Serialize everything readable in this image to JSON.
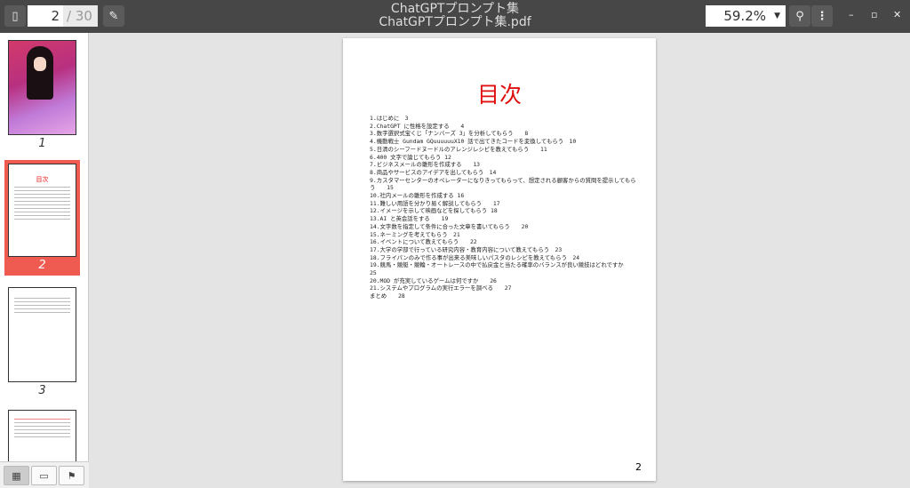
{
  "toolbar": {
    "current_page": "2",
    "total_pages": "/ 30",
    "title": "ChatGPTプロンプト集",
    "filename": "ChatGPTプロンプト集.pdf",
    "zoom": "59.2%"
  },
  "thumbnails": [
    {
      "label": "1"
    },
    {
      "label": "2"
    },
    {
      "label": "3"
    }
  ],
  "page": {
    "heading": "目次",
    "number": "2",
    "toc": [
      "1.はじめに　3",
      "2.ChatGPT に性格を設定する　　4",
      "3.数字選択式宝くじ「ナンバーズ 3」を分析してもらう　　8",
      "4.機動戦士 Gundam GQuuuuuuX10 話で出てきたコードを変換してもらう　10",
      "5.日清のシーフードヌードルのアレンジレシピを教えてもらう　　11",
      "6.400 文字で論じてもらう 12",
      "7.ビジネスメールの雛形を作成する　　13",
      "8.商品やサービスのアイデアを出してもらう　14",
      "9.カスタマーセンターのオペレーターになりきってもらって、想定される顧客からの質問を提示してもらう　　15",
      "10.社内メールの雛形を作成する 16",
      "11.難しい用語を分かり易く解説してもらう　　17",
      "12.イメージを示して映画などを探してもらう 18",
      "13.AI と英会話をする　　19",
      "14.文字数を指定して条件に合った文章を書いてもらう　　20",
      "15.ネーミングを考えてもらう　21",
      "16.イベントについて教えてもらう　　22",
      "17.大学の学部で行っている研究内容・教育内容について教えてもらう　23",
      "18.フライパンのみで作る事が出来る美味しいパスタのレシピを教えてもらう　24",
      "19.競馬・競艇・競輪・オートレースの中で払戻金と当たる確率のバランスが良い競技はどれですか　　25",
      "20.MOD が充実しているゲームは何ですか　　26",
      "21.システムやプログラムの実行エラーを調べる　　27",
      "まとめ　　28"
    ]
  }
}
